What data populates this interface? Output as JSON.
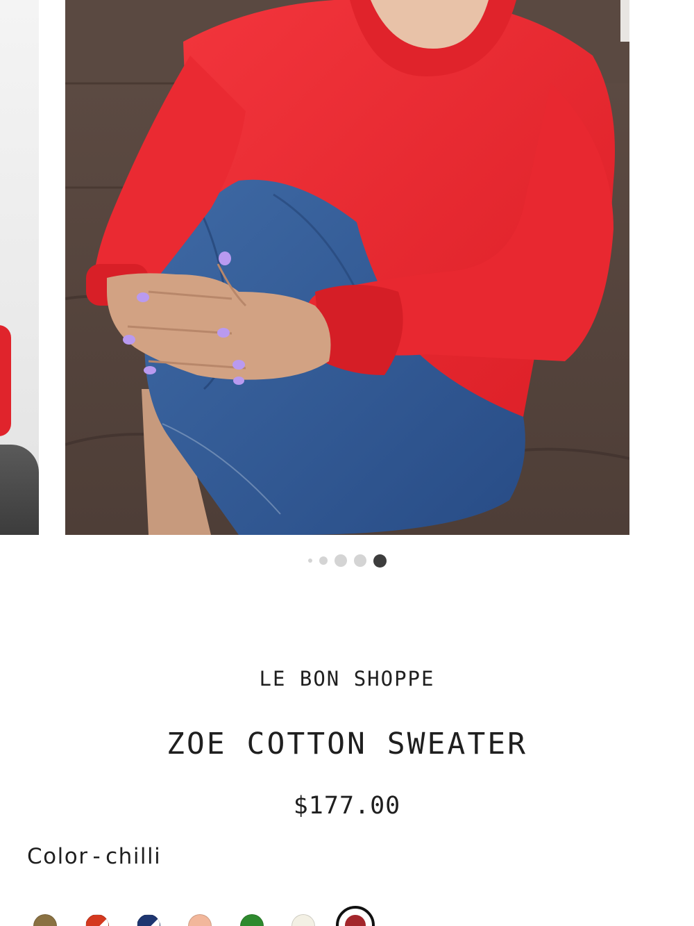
{
  "carousel": {
    "prev_slide_alt": "",
    "current_slide_alt": "",
    "dot_count": 5,
    "active_dot_index": 4
  },
  "product": {
    "brand": "LE BON SHOPPE",
    "title": "ZOE COTTON SWEATER",
    "price": "$177.00"
  },
  "color": {
    "label": "Color",
    "separator": "-",
    "selected": "chilli",
    "swatches": [
      {
        "name": "swatch-olive",
        "color": "#8a7142"
      },
      {
        "name": "swatch-red-white",
        "color": "#d4391f",
        "color2": "#ffffff"
      },
      {
        "name": "swatch-navy-white",
        "color": "#1e3670",
        "color2": "#ffffff"
      },
      {
        "name": "swatch-peach",
        "color": "#f2b79b"
      },
      {
        "name": "swatch-green",
        "color": "#2e8a2e"
      },
      {
        "name": "swatch-cream",
        "color": "#f3f0e4"
      },
      {
        "name": "swatch-chilli",
        "color": "#a3262b",
        "selected": true
      }
    ]
  },
  "colors": {
    "text": "#1f1f1f",
    "dot_active": "#3d3d3d",
    "dot_inactive": "#d4d4d4"
  }
}
